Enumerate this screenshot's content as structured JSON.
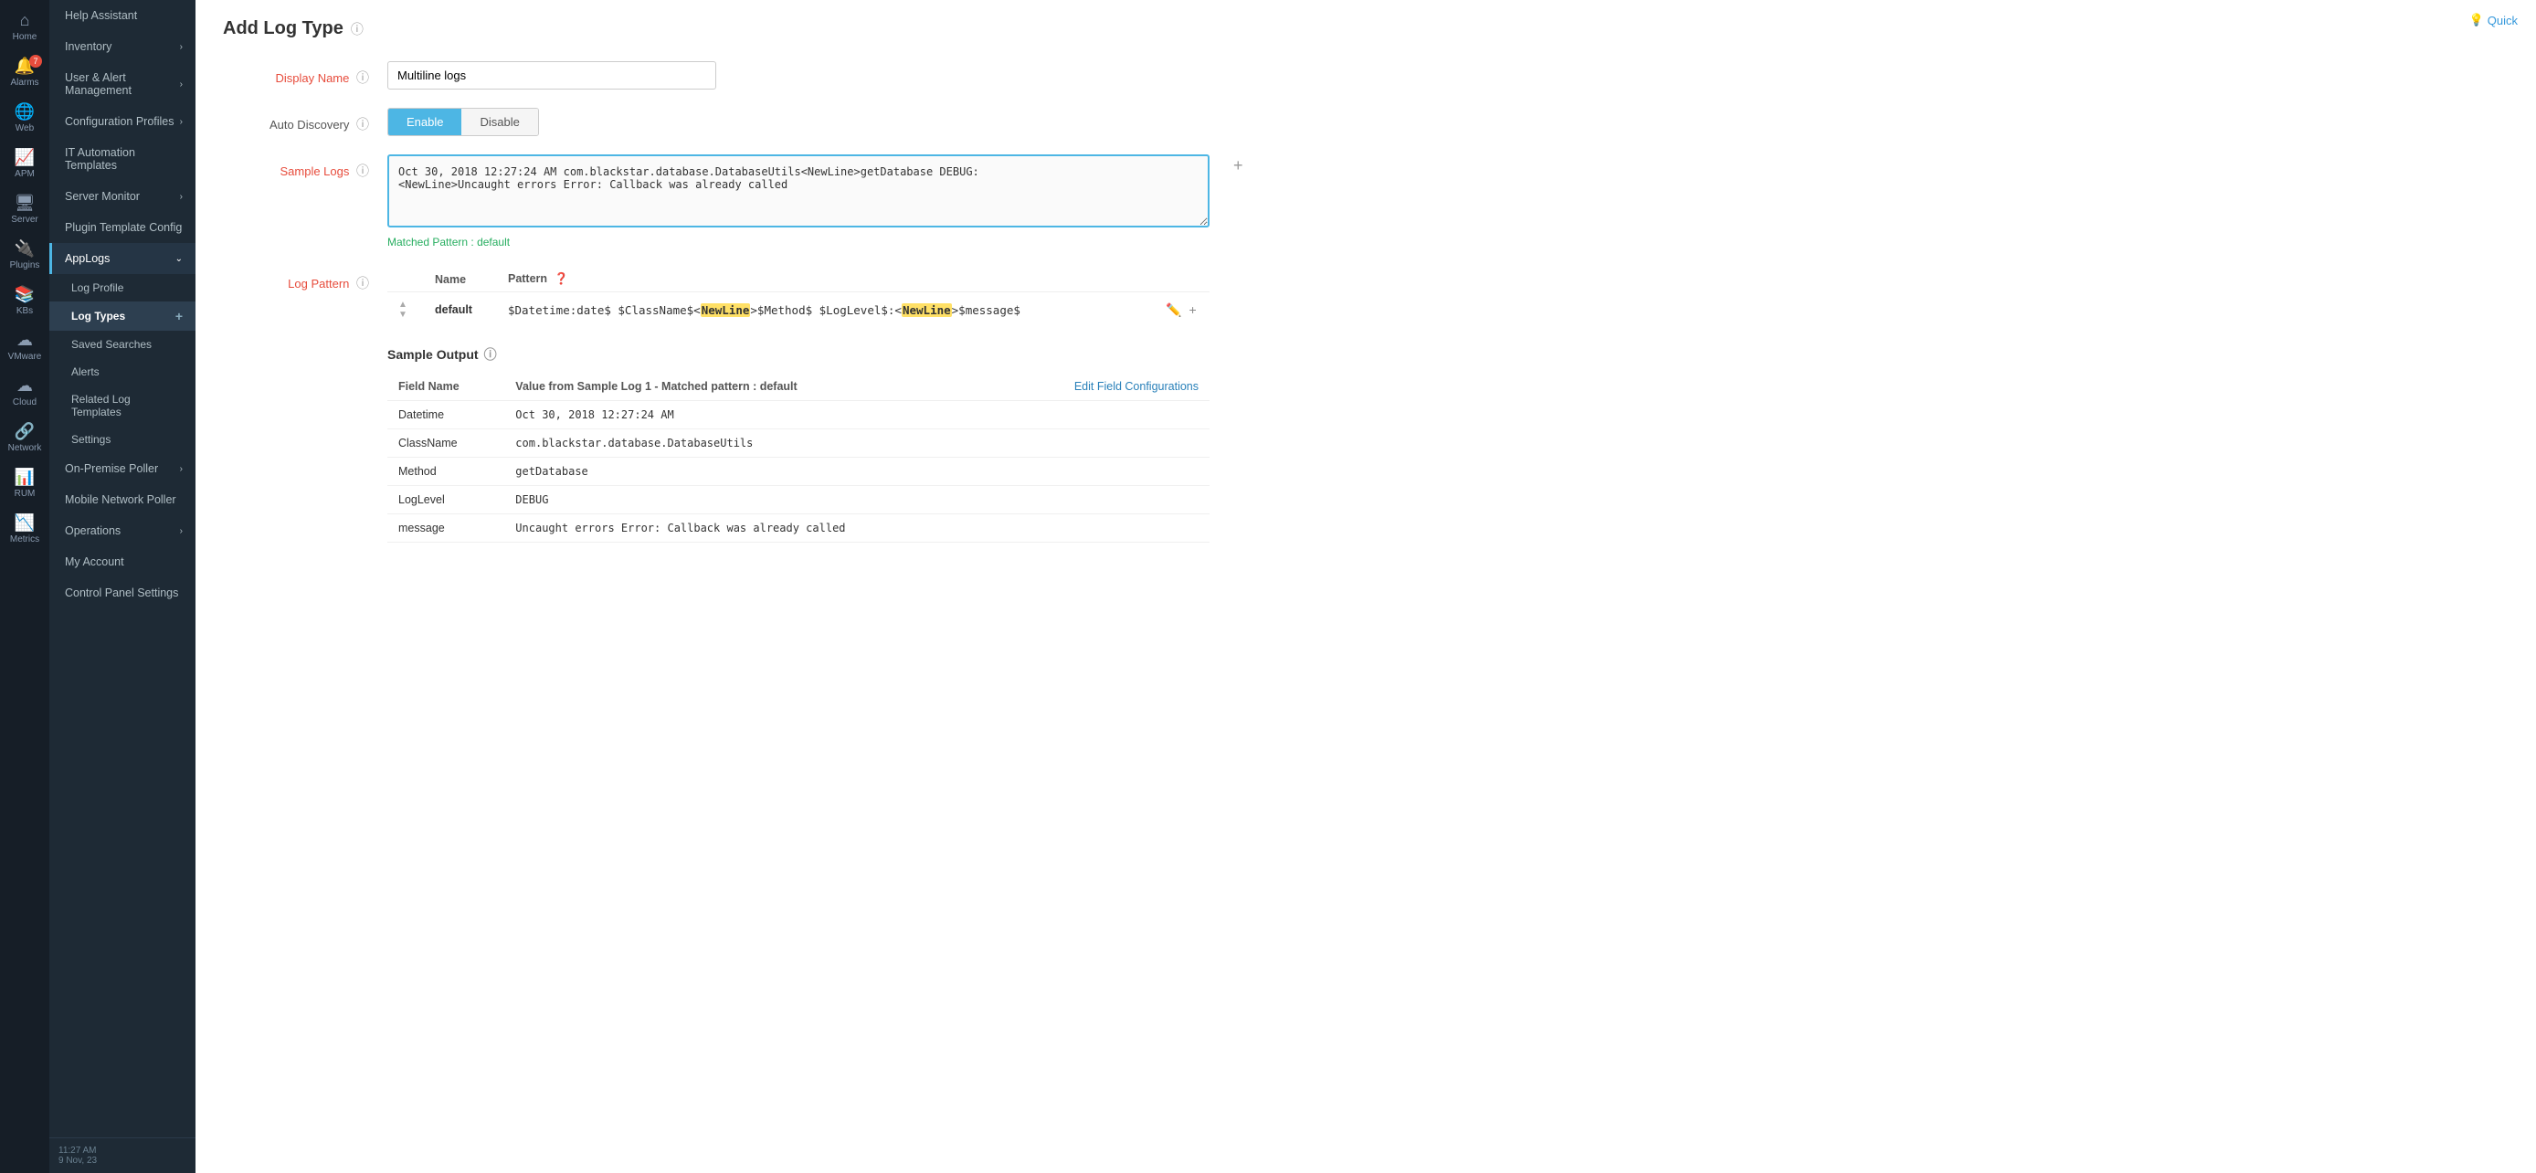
{
  "app": {
    "title": "Add Log Type",
    "quick_label": "Quick"
  },
  "sidebar_icons": [
    {
      "id": "home",
      "symbol": "⌂",
      "label": "Home",
      "badge": null
    },
    {
      "id": "alarms",
      "symbol": "🔔",
      "label": "Alarms",
      "badge": "7"
    },
    {
      "id": "web",
      "symbol": "🌐",
      "label": "Web",
      "badge": null
    },
    {
      "id": "apm",
      "symbol": "📈",
      "label": "APM",
      "badge": null
    },
    {
      "id": "server",
      "symbol": "🖥",
      "label": "Server",
      "badge": null
    },
    {
      "id": "plugins",
      "symbol": "🔌",
      "label": "Plugins",
      "badge": null
    },
    {
      "id": "kbs",
      "symbol": "📚",
      "label": "KBs",
      "badge": null
    },
    {
      "id": "vmware",
      "symbol": "☁",
      "label": "VMware",
      "badge": null
    },
    {
      "id": "cloud",
      "symbol": "☁",
      "label": "Cloud",
      "badge": null
    },
    {
      "id": "network",
      "symbol": "🔗",
      "label": "Network",
      "badge": null
    },
    {
      "id": "rum",
      "symbol": "📊",
      "label": "RUM",
      "badge": null
    },
    {
      "id": "metrics",
      "symbol": "📉",
      "label": "Metrics",
      "badge": null
    }
  ],
  "sidebar_menu": {
    "items": [
      {
        "id": "help-assistant",
        "label": "Help Assistant",
        "has_arrow": false
      },
      {
        "id": "inventory",
        "label": "Inventory",
        "has_arrow": true
      },
      {
        "id": "user-alert",
        "label": "User & Alert Management",
        "has_arrow": true
      },
      {
        "id": "config-profiles",
        "label": "Configuration Profiles",
        "has_arrow": true
      },
      {
        "id": "it-automation",
        "label": "IT Automation Templates",
        "has_arrow": false
      },
      {
        "id": "server-monitor",
        "label": "Server Monitor",
        "has_arrow": true
      },
      {
        "id": "plugin-template",
        "label": "Plugin Template Config",
        "has_arrow": false
      },
      {
        "id": "applogs",
        "label": "AppLogs",
        "has_arrow": true,
        "expanded": true
      }
    ],
    "submenu": [
      {
        "id": "log-profile",
        "label": "Log Profile"
      },
      {
        "id": "log-types",
        "label": "Log Types",
        "active": true,
        "has_plus": true
      },
      {
        "id": "saved-searches",
        "label": "Saved Searches"
      },
      {
        "id": "alerts",
        "label": "Alerts"
      },
      {
        "id": "related-log-templates",
        "label": "Related Log Templates"
      },
      {
        "id": "settings",
        "label": "Settings"
      }
    ],
    "bottom_items": [
      {
        "id": "on-premise-poller",
        "label": "On-Premise Poller",
        "has_arrow": true
      },
      {
        "id": "mobile-network",
        "label": "Mobile Network Poller",
        "has_arrow": false
      },
      {
        "id": "operations",
        "label": "Operations",
        "has_arrow": true
      },
      {
        "id": "my-account",
        "label": "My Account",
        "has_arrow": false
      },
      {
        "id": "control-panel",
        "label": "Control Panel Settings",
        "has_arrow": false
      }
    ]
  },
  "time_display": {
    "time": "11:27 AM",
    "date": "9 Nov, 23"
  },
  "form": {
    "display_name_label": "Display Name",
    "display_name_value": "Multiline logs",
    "display_name_placeholder": "Multiline logs",
    "auto_discovery_label": "Auto Discovery",
    "enable_label": "Enable",
    "disable_label": "Disable",
    "sample_logs_label": "Sample Logs",
    "sample_logs_value": "Oct 30, 2018 12:27:24 AM com.blackstar.database.DatabaseUtils<NewLine>getDatabase DEBUG:\n<NewLine>Uncaught errors Error: Callback was already called",
    "matched_pattern_prefix": "Matched Pattern",
    "matched_pattern_value": "default"
  },
  "log_pattern": {
    "label": "Log Pattern",
    "col_name": "Name",
    "col_pattern": "Pattern",
    "rows": [
      {
        "id": "default",
        "name": "default",
        "pattern_prefix": "$Datetime:date$ $ClassName$<",
        "pattern_newline1": "NewLine",
        "pattern_middle": ">$Method$ $LogLevel$:<",
        "pattern_newline2": "NewLine",
        "pattern_suffix": ">$message$"
      }
    ]
  },
  "sample_output": {
    "title": "Sample Output",
    "col_field": "Field Name",
    "col_value_prefix": "Value from Sample Log 1 - Matched pattern :",
    "col_value_pattern": "default",
    "edit_link": "Edit Field Configurations",
    "rows": [
      {
        "field": "Datetime",
        "value": "Oct 30, 2018 12:27:24 AM"
      },
      {
        "field": "ClassName",
        "value": "com.blackstar.database.DatabaseUtils"
      },
      {
        "field": "Method",
        "value": "getDatabase"
      },
      {
        "field": "LogLevel",
        "value": "DEBUG"
      },
      {
        "field": "message",
        "value": "Uncaught errors Error: Callback was already called"
      }
    ]
  }
}
